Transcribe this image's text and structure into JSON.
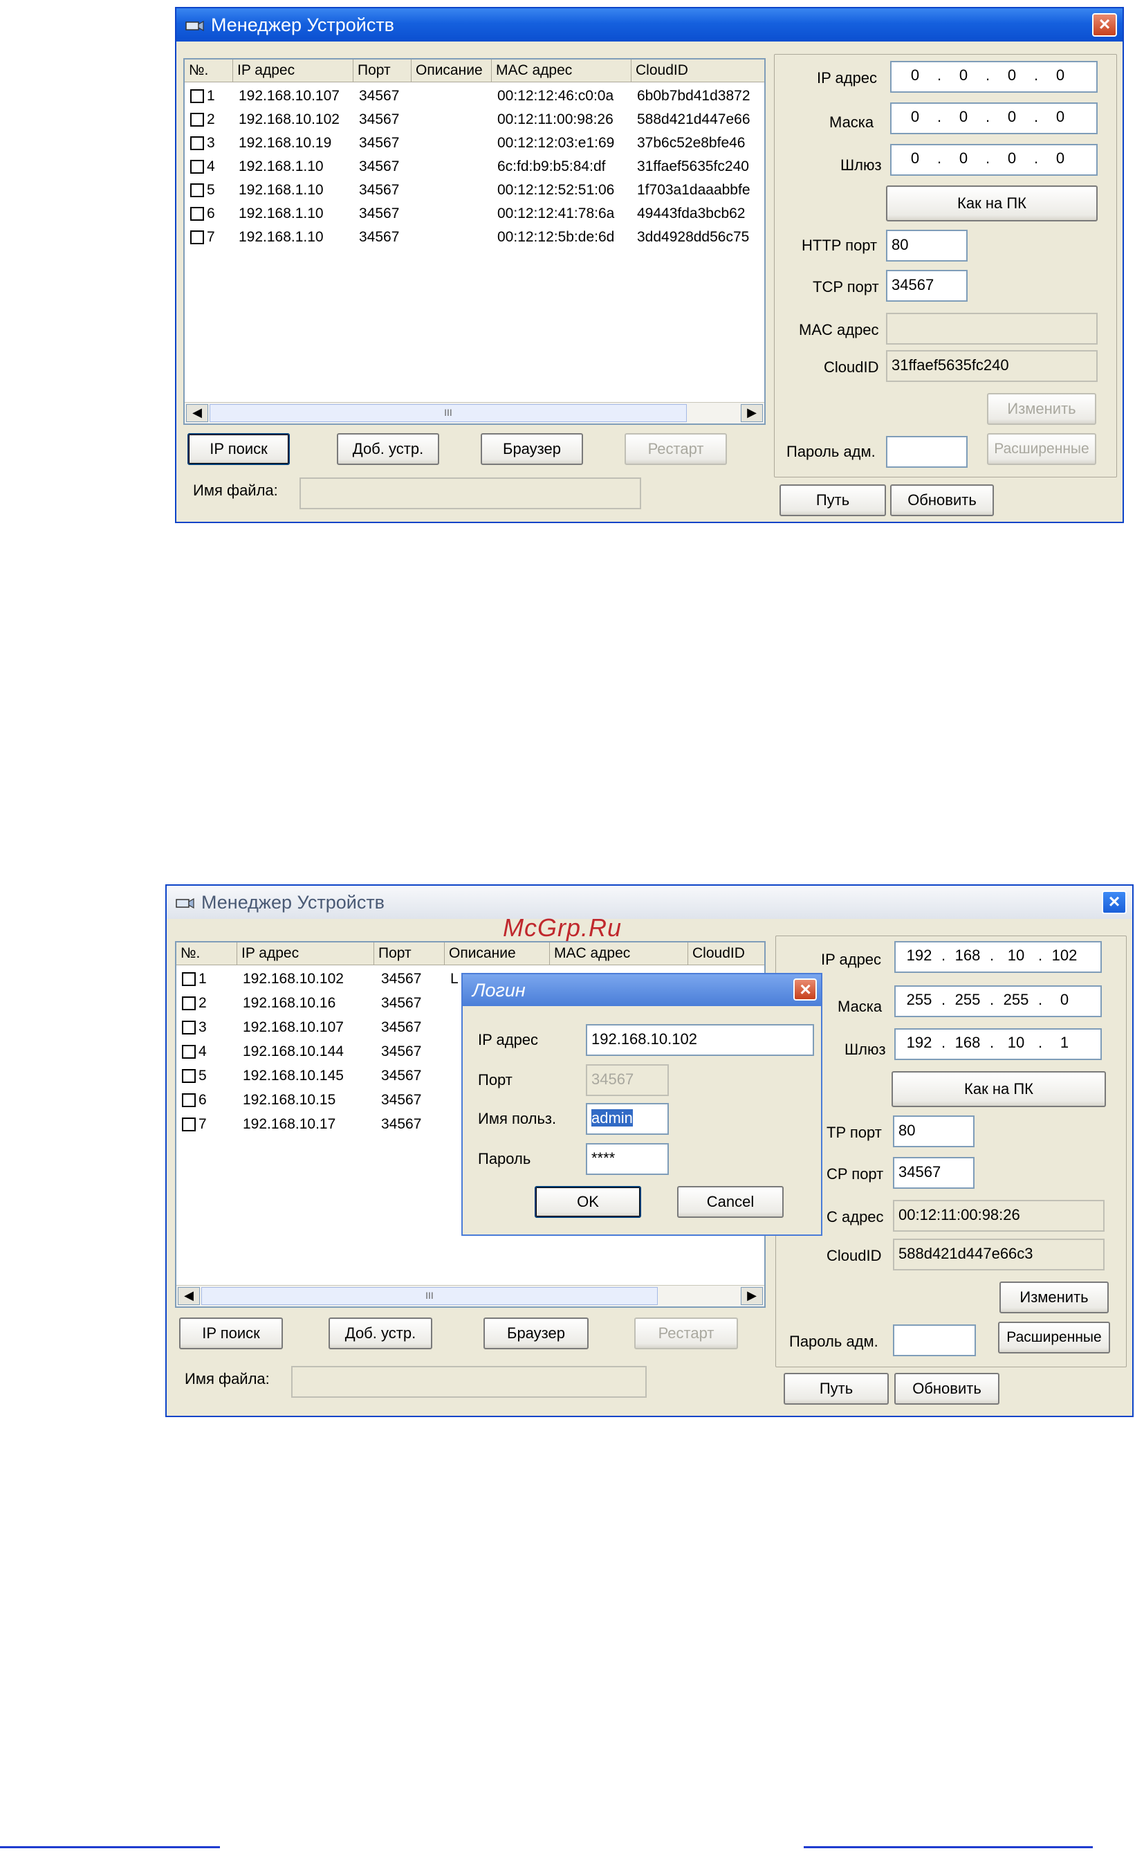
{
  "window1": {
    "title": "Менеджер Устройств",
    "columns": [
      "№.",
      "IP адрес",
      "Порт",
      "Описание",
      "MAC адрес",
      "CloudID"
    ],
    "rows": [
      {
        "num": "1",
        "ip": "192.168.10.107",
        "port": "34567",
        "desc": "",
        "mac": "00:12:12:46:c0:0a",
        "cloud": "6b0b7bd41d3872"
      },
      {
        "num": "2",
        "ip": "192.168.10.102",
        "port": "34567",
        "desc": "",
        "mac": "00:12:11:00:98:26",
        "cloud": "588d421d447e66"
      },
      {
        "num": "3",
        "ip": "192.168.10.19",
        "port": "34567",
        "desc": "",
        "mac": "00:12:12:03:e1:69",
        "cloud": "37b6c52e8bfe46"
      },
      {
        "num": "4",
        "ip": "192.168.1.10",
        "port": "34567",
        "desc": "",
        "mac": "6c:fd:b9:b5:84:df",
        "cloud": "31ffaef5635fc240"
      },
      {
        "num": "5",
        "ip": "192.168.1.10",
        "port": "34567",
        "desc": "",
        "mac": "00:12:12:52:51:06",
        "cloud": "1f703a1daaabbfe"
      },
      {
        "num": "6",
        "ip": "192.168.1.10",
        "port": "34567",
        "desc": "",
        "mac": "00:12:12:41:78:6a",
        "cloud": "49443fda3bcb62"
      },
      {
        "num": "7",
        "ip": "192.168.1.10",
        "port": "34567",
        "desc": "",
        "mac": "00:12:12:5b:de:6d",
        "cloud": "3dd4928dd56c75"
      }
    ],
    "scroll_thumb": "III",
    "buttons": {
      "ip_search": "IP поиск",
      "add_device": "Доб. устр.",
      "browser": "Браузер",
      "restart": "Рестарт"
    },
    "file_label": "Имя файла:",
    "file_value": "",
    "labels": {
      "ip": "IP адрес",
      "mask": "Маска",
      "gateway": "Шлюз",
      "http": "HTTP порт",
      "tcp": "TCP порт",
      "mac": "MAC адрес",
      "cloud": "CloudID",
      "admin_pwd": "Пароль адм."
    },
    "ip": [
      "0",
      "0",
      "0",
      "0"
    ],
    "mask": [
      "0",
      "0",
      "0",
      "0"
    ],
    "gateway": [
      "0",
      "0",
      "0",
      "0"
    ],
    "http_port": "80",
    "tcp_port": "34567",
    "mac_value": "",
    "cloud_value": "31ffaef5635fc240",
    "admin_pwd": "",
    "right_buttons": {
      "as_pc": "Как на ПК",
      "change": "Изменить",
      "advanced": "Расширенные",
      "path": "Путь",
      "refresh": "Обновить"
    }
  },
  "window2": {
    "title": "Менеджер Устройств",
    "watermark": "McGrp.Ru",
    "columns": [
      "№.",
      "IP адрес",
      "Порт",
      "Описание",
      "MAC адрес",
      "CloudID"
    ],
    "rows": [
      {
        "num": "1",
        "ip": "192.168.10.102",
        "port": "34567",
        "desc": "L"
      },
      {
        "num": "2",
        "ip": "192.168.10.16",
        "port": "34567",
        "desc": ""
      },
      {
        "num": "3",
        "ip": "192.168.10.107",
        "port": "34567",
        "desc": ""
      },
      {
        "num": "4",
        "ip": "192.168.10.144",
        "port": "34567",
        "desc": ""
      },
      {
        "num": "5",
        "ip": "192.168.10.145",
        "port": "34567",
        "desc": ""
      },
      {
        "num": "6",
        "ip": "192.168.10.15",
        "port": "34567",
        "desc": ""
      },
      {
        "num": "7",
        "ip": "192.168.10.17",
        "port": "34567",
        "desc": ""
      }
    ],
    "scroll_thumb": "III",
    "buttons": {
      "ip_search": "IP поиск",
      "add_device": "Доб. устр.",
      "browser": "Браузер",
      "restart": "Рестарт"
    },
    "file_label": "Имя файла:",
    "file_value": "",
    "labels": {
      "ip": "IP адрес",
      "mask": "Маска",
      "gateway": "Шлюз",
      "http": "TP порт",
      "tcp": "CP порт",
      "mac": "С адрес",
      "cloud": "CloudID",
      "admin_pwd": "Пароль адм."
    },
    "ip": [
      "192",
      "168",
      "10",
      "102"
    ],
    "mask": [
      "255",
      "255",
      "255",
      "0"
    ],
    "gateway": [
      "192",
      "168",
      "10",
      "1"
    ],
    "http_port": "80",
    "tcp_port": "34567",
    "mac_value": "00:12:11:00:98:26",
    "cloud_value": "588d421d447e66c3",
    "admin_pwd": "",
    "right_buttons": {
      "as_pc": "Как на ПК",
      "change": "Изменить",
      "advanced": "Расширенные",
      "path": "Путь",
      "refresh": "Обновить"
    },
    "login": {
      "title": "Логин",
      "ip_label": "IP адрес",
      "ip_value": "192.168.10.102",
      "port_label": "Порт",
      "port_value": "34567",
      "user_label": "Имя польз.",
      "user_value": "admin",
      "pwd_label": "Пароль",
      "pwd_value": "****",
      "ok": "OK",
      "cancel": "Cancel"
    }
  },
  "colors": {
    "title_blue": "#1560de",
    "frame": "#ece9d8",
    "watermark": "#c0282d",
    "footer_line": "#1f3cd0"
  }
}
